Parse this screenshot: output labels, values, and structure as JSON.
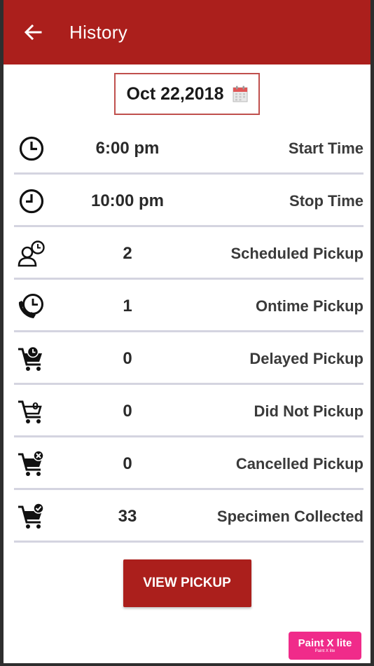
{
  "appbar": {
    "title": "History",
    "back_icon": "arrow-left-icon",
    "color": "#ab1f1c"
  },
  "date_picker": {
    "value": "Oct 22,2018",
    "icon": "calendar-icon"
  },
  "rows": [
    {
      "icon": "clock-icon",
      "value": "6:00 pm",
      "label": "Start Time"
    },
    {
      "icon": "clock-icon",
      "value": "10:00 pm",
      "label": "Stop Time"
    },
    {
      "icon": "person-clock-icon",
      "value": "2",
      "label": "Scheduled Pickup"
    },
    {
      "icon": "phone-clock-icon",
      "value": "1",
      "label": "Ontime Pickup"
    },
    {
      "icon": "cart-clock-icon",
      "value": "0",
      "label": "Delayed Pickup"
    },
    {
      "icon": "cart-empty-icon",
      "value": "0",
      "label": "Did Not Pickup"
    },
    {
      "icon": "cart-cancel-icon",
      "value": "0",
      "label": "Cancelled Pickup"
    },
    {
      "icon": "cart-check-icon",
      "value": "33",
      "label": "Specimen Collected"
    }
  ],
  "actions": {
    "view_pickup_label": "VIEW PICKUP"
  },
  "watermark": {
    "main": "Paint X lite",
    "sub": "Paint X lite"
  }
}
